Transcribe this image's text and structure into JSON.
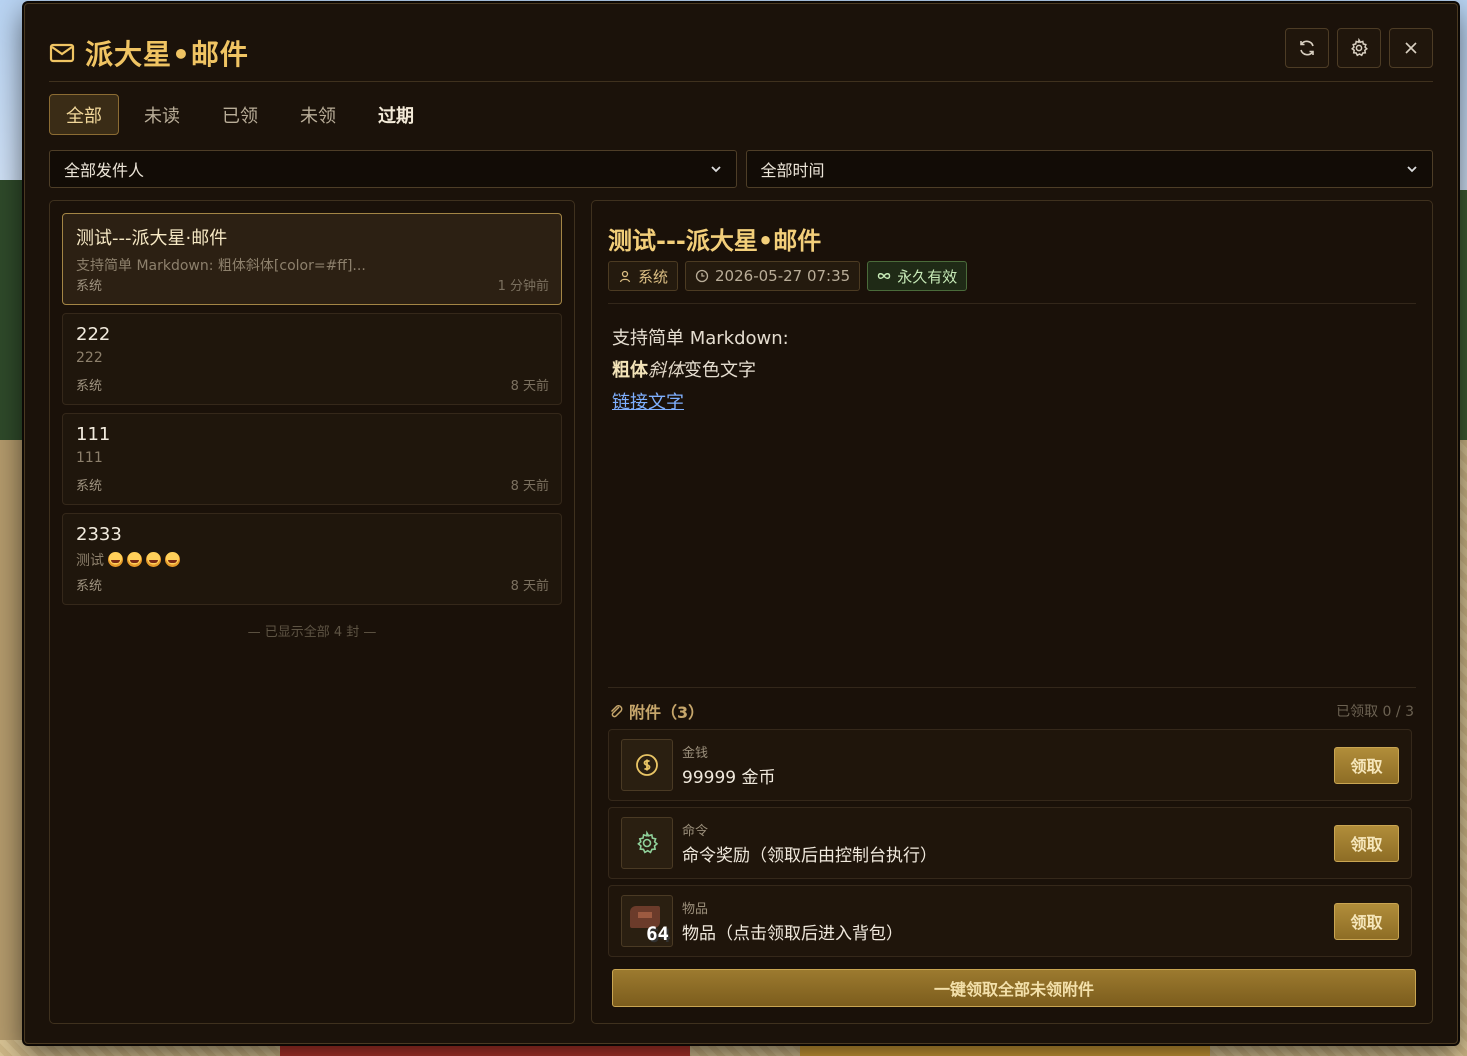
{
  "window": {
    "title": "派大星•邮件",
    "icons": {
      "title": "mail-icon",
      "refresh": "refresh-icon",
      "settings": "gear-icon",
      "close": "close-icon"
    }
  },
  "tabs": [
    {
      "label": "全部",
      "active": true
    },
    {
      "label": "未读"
    },
    {
      "label": "已领"
    },
    {
      "label": "未领"
    },
    {
      "label": "过期"
    }
  ],
  "filters": {
    "sender": "全部发件人",
    "time": "全部时间"
  },
  "mails": [
    {
      "title": "测试---派大星·邮件",
      "preview": "支持简单 Markdown: 粗体斜体[color=#ff]...",
      "sender": "系统",
      "time": "1 分钟前",
      "selected": true
    },
    {
      "title": "222",
      "preview": "222",
      "sender": "系统",
      "time": "8 天前"
    },
    {
      "title": "111",
      "preview": "111",
      "sender": "系统",
      "time": "8 天前"
    },
    {
      "title": "2333",
      "preview": "测试",
      "sender": "系统",
      "time": "8 天前"
    }
  ],
  "list_footer": "— 已显示全部 4 封 —",
  "detail": {
    "title": "测试---派大星•邮件",
    "sender": "系统",
    "date": "2026-05-27 07:35",
    "validity": "永久有效",
    "body_line1": "支持简单 Markdown:",
    "body_bold": "粗体",
    "body_italic": "斜体",
    "body_colored": "变色文字",
    "body_link": "链接文字",
    "attachments_title": "附件（3）",
    "attachments_count": "已领取 0 / 3",
    "attachments": [
      {
        "type": "金钱",
        "name": "99999 金币",
        "icon": "coin-icon",
        "button": "领取"
      },
      {
        "type": "命令",
        "name": "命令奖励（领取后由控制台执行）",
        "icon": "gear-icon",
        "button": "领取"
      },
      {
        "type": "物品",
        "name": "物品（点击领取后进入背包）",
        "icon": "item-icon",
        "quantity": "64",
        "button": "领取"
      }
    ],
    "claim_all": "一键领取全部未领附件"
  },
  "colors": {
    "accent": "#f0c463",
    "panel": "#1b120a",
    "button": "#9c7a2f"
  }
}
